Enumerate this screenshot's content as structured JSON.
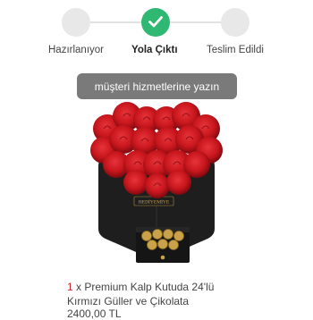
{
  "tracker": {
    "steps": [
      {
        "label": "Hazırlanıyor",
        "state": "inactive"
      },
      {
        "label": "Yola Çıktı",
        "state": "active",
        "icon": "check-icon"
      },
      {
        "label": "Teslim Edildi",
        "state": "inactive"
      }
    ],
    "colors": {
      "active": "#2eb872",
      "inactive": "#e8e8e8"
    }
  },
  "support_button": {
    "label": "müşteri hizmetlerine yazın"
  },
  "product": {
    "quantity": "1",
    "quantity_suffix": "x",
    "name_line1": "Premium Kalp Kutuda 24'lü",
    "name_line2": "Kırmızı Güller ve Çikolata",
    "price": "2400,00 TL",
    "brand_text": "HEDİYEMİYE",
    "colors": {
      "quantity": "#d2262d",
      "rose": "#c8161d",
      "box": "#1e1e1e"
    }
  }
}
